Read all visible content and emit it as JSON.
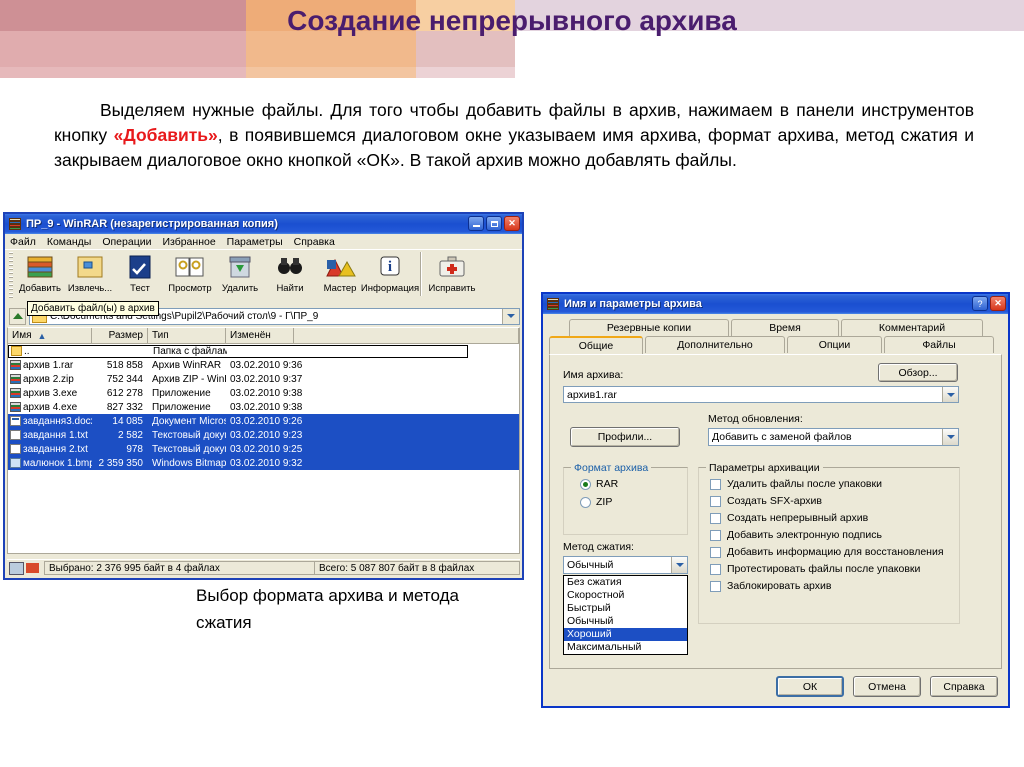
{
  "slide": {
    "title": "Создание непрерывного архива",
    "paragraph_part1": "Выделяем нужные файлы. Для того чтобы добавить файлы в архив, нажимаем в панели инструментов кнопку ",
    "paragraph_highlight": "«Добавить»",
    "paragraph_part2": ", в появившемся диалоговом окне указываем имя архива, формат архива, метод сжатия и закрываем диалоговое окно кнопкой «ОК». В такой архив можно добавлять файлы.",
    "caption": "Выбор формата архива и метода сжатия",
    "accent_red": "#e8191b",
    "title_color": "#4a1d6e",
    "bracket_color": "#c00000"
  },
  "winrar": {
    "title": "ПР_9 - WinRAR (незарегистрированная копия)",
    "window_buttons": {
      "minimize": "_",
      "maximize": "□",
      "close": "✕"
    },
    "menu": [
      "Файл",
      "Команды",
      "Операции",
      "Избранное",
      "Параметры",
      "Справка"
    ],
    "toolbar": [
      {
        "label": "Добавить",
        "icon": "add-archive-icon"
      },
      {
        "label": "Извлечь...",
        "icon": "extract-icon"
      },
      {
        "label": "Тест",
        "icon": "test-icon"
      },
      {
        "label": "Просмотр",
        "icon": "view-icon"
      },
      {
        "label": "Удалить",
        "icon": "delete-icon"
      },
      {
        "label": "Найти",
        "icon": "find-icon"
      },
      {
        "label": "Мастер",
        "icon": "wizard-icon"
      },
      {
        "label": "Информация",
        "icon": "info-icon"
      },
      {
        "label": "Исправить",
        "icon": "repair-icon"
      }
    ],
    "tooltip": "Добавить файл(ы) в архив",
    "address": "C:\\Documents and Settings\\Pupil2\\Рабочий стол\\9 - Г\\ПР_9",
    "columns": [
      "Имя",
      "Размер",
      "Тип",
      "Изменён"
    ],
    "parent_row": {
      "name": "..",
      "type": "Папка с файлами"
    },
    "rows": [
      {
        "name": "архив 1.rar",
        "size": "518 858",
        "type": "Архив WinRAR",
        "modified": "03.02.2010 9:36",
        "icon": "rar-icon",
        "selected": false
      },
      {
        "name": "архив 2.zip",
        "size": "752 344",
        "type": "Архив ZIP - WinRAR",
        "modified": "03.02.2010 9:37",
        "icon": "rar-icon",
        "selected": false
      },
      {
        "name": "архив 3.exe",
        "size": "612 278",
        "type": "Приложение",
        "modified": "03.02.2010 9:38",
        "icon": "rar-icon",
        "selected": false
      },
      {
        "name": "архив 4.exe",
        "size": "827 332",
        "type": "Приложение",
        "modified": "03.02.2010 9:38",
        "icon": "rar-icon",
        "selected": false
      },
      {
        "name": "завдання3.docx",
        "size": "14 085",
        "type": "Документ Microsof...",
        "modified": "03.02.2010 9:26",
        "icon": "doc-icon",
        "selected": true
      },
      {
        "name": "завдання 1.txt",
        "size": "2 582",
        "type": "Текстовый документ",
        "modified": "03.02.2010 9:23",
        "icon": "txt-icon",
        "selected": true
      },
      {
        "name": "завдання 2.txt",
        "size": "978",
        "type": "Текстовый документ",
        "modified": "03.02.2010 9:25",
        "icon": "txt-icon",
        "selected": true
      },
      {
        "name": "малюнок 1.bmp",
        "size": "2 359 350",
        "type": "Windows Bitmap Im...",
        "modified": "03.02.2010 9:32",
        "icon": "bmp-icon",
        "selected": true
      }
    ],
    "status_left": "Выбрано: 2 376 995 байт в 4 файлах",
    "status_right": "Всего: 5 087 807 байт в 8 файлах"
  },
  "dialog": {
    "title": "Имя и параметры архива",
    "help_button": "?",
    "close_button": "✕",
    "tabs_top": [
      "Резервные копии",
      "Время",
      "Комментарий"
    ],
    "tabs_bottom": [
      "Общие",
      "Дополнительно",
      "Опции",
      "Файлы"
    ],
    "active_tab": "Общие",
    "archive_name_label": "Имя архива:",
    "archive_name_value": "архив1.rar",
    "browse_button": "Обзор...",
    "profiles_button": "Профили...",
    "update_method_label": "Метод обновления:",
    "update_method_value": "Добавить с заменой файлов",
    "format_group_label": "Формат архива",
    "format_options": [
      {
        "label": "RAR",
        "selected": true
      },
      {
        "label": "ZIP",
        "selected": false
      }
    ],
    "compression_label": "Метод сжатия:",
    "compression_value": "Обычный",
    "compression_options": [
      {
        "label": "Без сжатия",
        "highlighted": false
      },
      {
        "label": "Скоростной",
        "highlighted": false
      },
      {
        "label": "Быстрый",
        "highlighted": false
      },
      {
        "label": "Обычный",
        "highlighted": false
      },
      {
        "label": "Хороший",
        "highlighted": true
      },
      {
        "label": "Максимальный",
        "highlighted": false
      }
    ],
    "options_group_label": "Параметры архивации",
    "options": [
      {
        "label": "Удалить файлы после упаковки",
        "checked": false
      },
      {
        "label": "Создать SFX-архив",
        "checked": false
      },
      {
        "label": "Создать непрерывный архив",
        "checked": false
      },
      {
        "label": "Добавить электронную подпись",
        "checked": false
      },
      {
        "label": "Добавить информацию для восстановления",
        "checked": false
      },
      {
        "label": "Протестировать файлы после упаковки",
        "checked": false
      },
      {
        "label": "Заблокировать архив",
        "checked": false
      }
    ],
    "buttons": {
      "ok": "ОК",
      "cancel": "Отмена",
      "help": "Справка"
    }
  }
}
